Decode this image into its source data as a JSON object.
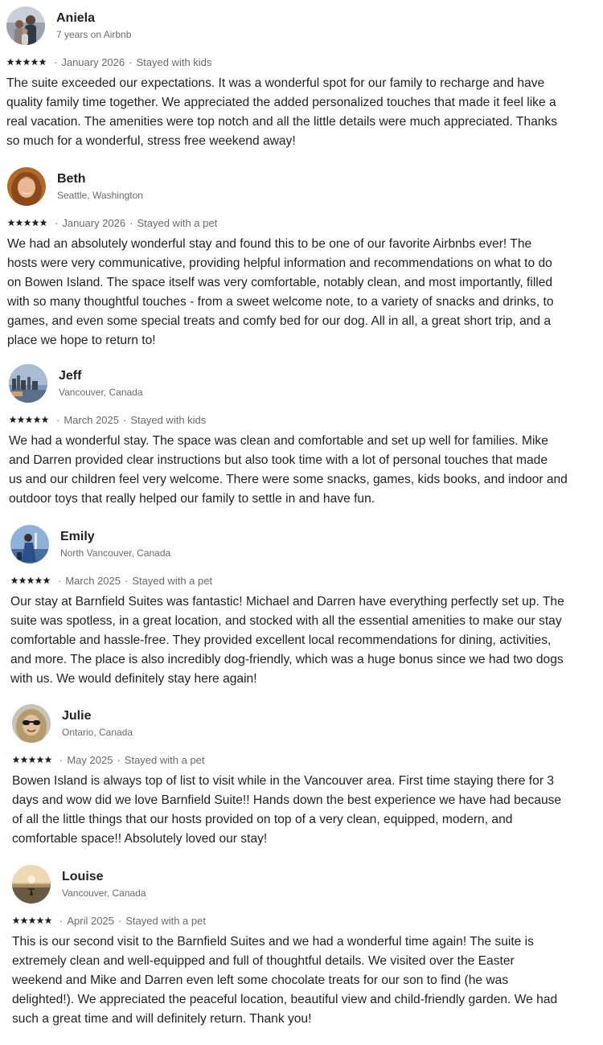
{
  "reviews": [
    {
      "name": "Aniela",
      "subtitle": "7 years on Airbnb",
      "rating": 5,
      "date": "January 2026",
      "stay_type": "Stayed with kids",
      "text": "The suite exceeded our expectations. It was a wonderful spot for our family to recharge and have\nquality family time together. We appreciated the added personalized touches that made it feel like a\nreal vacation. The amenities were top notch and all the little details were much appreciated. Thanks\nso much for a wonderful, stress free weekend away!",
      "avatar_icon": "family-photo-avatar"
    },
    {
      "name": "Beth",
      "subtitle": "Seattle, Washington",
      "rating": 5,
      "date": "January 2026",
      "stay_type": "Stayed with a pet",
      "text": "We had an absolutely wonderful stay and found this to be one of our favorite Airbnbs ever! The\nhosts were very communicative, providing helpful information and recommendations on what to do\non Bowen Island. The space itself was very comfortable, notably clean, and most importantly, filled\nwith so many thoughtful touches - from a sweet welcome note, to a variety of snacks and drinks, to\ngames, and even some special treats and comfy bed for our dog. All in all, a great short trip, and a\nplace we hope to return to!",
      "avatar_icon": "portrait-photo-avatar"
    },
    {
      "name": "Jeff",
      "subtitle": "Vancouver, Canada",
      "rating": 5,
      "date": "March 2025",
      "stay_type": "Stayed with kids",
      "text": "We had a wonderful stay. The space was clean and comfortable and set up well for families. Mike\nand Darren provided clear instructions but also took time with a lot of personal touches that made\nus and our children feel very welcome. There were some snacks, games, kids books, and indoor and\noutdoor toys that really helped our family to settle in and have fun.",
      "avatar_icon": "city-skyline-avatar"
    },
    {
      "name": "Emily",
      "subtitle": "North Vancouver, Canada",
      "rating": 5,
      "date": "March 2025",
      "stay_type": "Stayed with a pet",
      "text": "Our stay at Barnfield Suites was fantastic! Michael and Darren have everything perfectly set up. The\nsuite was spotless, in a great location, and stocked with all the essential amenities to make our stay\ncomfortable and hassle-free. They provided excellent local recommendations for dining, activities,\nand more. The place is also incredibly dog-friendly, which was a huge bonus since we had two dogs\nwith us. We would definitely stay here again!",
      "avatar_icon": "outdoor-photo-avatar"
    },
    {
      "name": "Julie",
      "subtitle": "Ontario, Canada",
      "rating": 5,
      "date": "May 2025",
      "stay_type": "Stayed with a pet",
      "text": "Bowen Island is always top of list to visit while in the Vancouver area. First time staying there for 3\ndays and wow did we love Barnfield Suite!!  Hands down the best experience we have had because\nof all the little things that our hosts provided on top of a very clean, equipped, modern, and\ncomfortable space!! Absolutely loved our stay!",
      "avatar_icon": "sunglasses-portrait-avatar"
    },
    {
      "name": "Louise",
      "subtitle": "Vancouver, Canada",
      "rating": 5,
      "date": "April 2025",
      "stay_type": "Stayed with a pet",
      "text": "This is our second visit to the Barnfield Suites and we had a wonderful time again! The suite is\nextremely clean and well-equipped and full of thoughtful details. We visited over the Easter\nweekend and Mike and Darren even left some chocolate treats for our son to find (he was\ndelighted!). We appreciated the peaceful location, beautiful view and child-friendly garden. We had\nsuch a great time and will definitely return. Thank you!",
      "avatar_icon": "beach-sunset-avatar"
    }
  ],
  "separator": "·",
  "colors": {
    "text": "#222222",
    "muted": "#6a6a6a",
    "star": "#222222"
  }
}
